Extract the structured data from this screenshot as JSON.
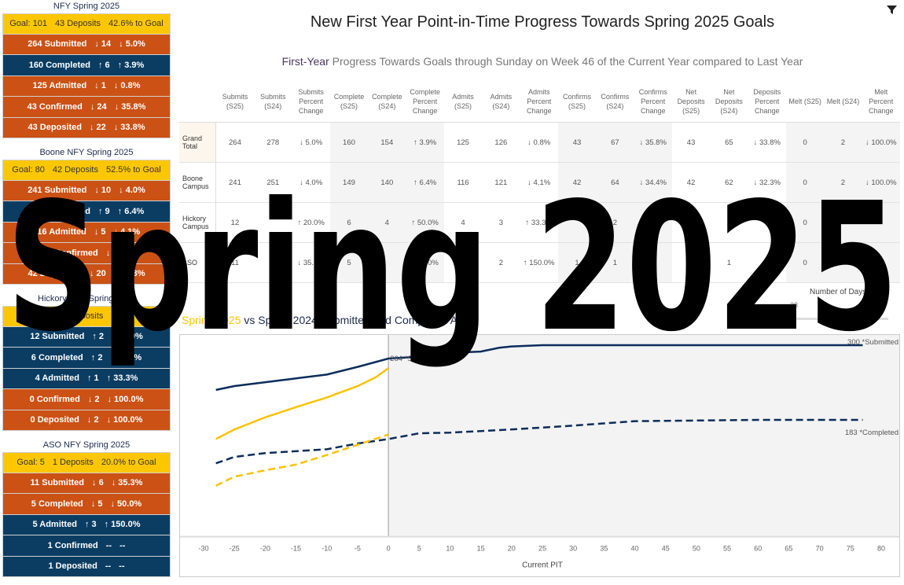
{
  "left_panel": [
    {
      "title": "NFY Spring 2025",
      "goal": [
        "Goal: 101",
        "43 Deposits",
        "42.6% to Goal"
      ],
      "rows": [
        {
          "parts": [
            "264 Submitted",
            "↓ 14",
            "↓ 5.0%"
          ],
          "color": "#cb5115"
        },
        {
          "parts": [
            "160 Completed",
            "↑ 6",
            "↑ 3.9%"
          ],
          "color": "#0b3d63"
        },
        {
          "parts": [
            "125 Admitted",
            "↓ 1",
            "↓ 0.8%"
          ],
          "color": "#cb5115"
        },
        {
          "parts": [
            "43 Confirmed",
            "↓ 24",
            "↓ 35.8%"
          ],
          "color": "#cb5115"
        },
        {
          "parts": [
            "43 Deposited",
            "↓ 22",
            "↓ 33.8%"
          ],
          "color": "#cb5115"
        }
      ]
    },
    {
      "title": "Boone NFY Spring 2025",
      "goal": [
        "Goal: 80",
        "42 Deposits",
        "52.5% to Goal"
      ],
      "rows": [
        {
          "parts": [
            "241 Submitted",
            "↓ 10",
            "↓ 4.0%"
          ],
          "color": "#cb5115"
        },
        {
          "parts": [
            "149 Completed",
            "↑ 9",
            "↑ 6.4%"
          ],
          "color": "#0b3d63"
        },
        {
          "parts": [
            "116 Admitted",
            "↓ 5",
            "↓ 4.1%"
          ],
          "color": "#cb5115"
        },
        {
          "parts": [
            "42 Confirmed",
            "↓ 22",
            ""
          ],
          "color": "#cb5115"
        },
        {
          "parts": [
            "42 Deposited",
            "↓ 20",
            "↓ 32.3%"
          ],
          "color": "#cb5115"
        }
      ]
    },
    {
      "title": "Hickory NFY Spring 2025",
      "goal": [
        "",
        "Deposits",
        ""
      ],
      "rows": [
        {
          "parts": [
            "12 Submitted",
            "↑ 2",
            "↑ 20.0%"
          ],
          "color": "#0b3d63"
        },
        {
          "parts": [
            "6 Completed",
            "↑ 2",
            "↑ 50.0%"
          ],
          "color": "#0b3d63"
        },
        {
          "parts": [
            "4 Admitted",
            "↑ 1",
            "↑ 33.3%"
          ],
          "color": "#0b3d63"
        },
        {
          "parts": [
            "0 Confirmed",
            "↓ 2",
            "↓ 100.0%"
          ],
          "color": "#cb5115"
        },
        {
          "parts": [
            "0 Deposited",
            "↓ 2",
            "↓ 100.0%"
          ],
          "color": "#cb5115"
        }
      ]
    },
    {
      "title": "ASO NFY Spring 2025",
      "goal": [
        "Goal: 5",
        "1 Deposits",
        "20.0% to Goal"
      ],
      "rows": [
        {
          "parts": [
            "11 Submitted",
            "↓ 6",
            "↓ 35.3%"
          ],
          "color": "#cb5115"
        },
        {
          "parts": [
            "5 Completed",
            "↓ 5",
            "↓ 50.0%"
          ],
          "color": "#cb5115"
        },
        {
          "parts": [
            "5 Admitted",
            "↑ 3",
            "↑ 150.0%"
          ],
          "color": "#0b3d63"
        },
        {
          "parts": [
            "1 Confirmed",
            "--",
            "--"
          ],
          "color": "#0b3d63"
        },
        {
          "parts": [
            "1 Deposited",
            "--",
            "--"
          ],
          "color": "#0b3d63"
        }
      ]
    }
  ],
  "goal_color": "#fdc700",
  "header": {
    "title": "New First Year Point-in-Time Progress Towards Spring 2025 Goals",
    "subtitle_highlight": "First-Year",
    "subtitle_rest": " Progress Towards Goals through Sunday on Week 46 of the Current Year compared to Last Year",
    "filter_icon": "funnel-icon"
  },
  "table": {
    "columns": [
      "Submits (S25)",
      "Submits (S24)",
      "Submits Percent Change",
      "Complete (S25)",
      "Complete (S24)",
      "Complete Percent Change",
      "Admits (S25)",
      "Admits (S24)",
      "Admits Percent Change",
      "Confirms (S25)",
      "Confirms (S24)",
      "Confirms Percent Change",
      "Net Deposits (S25)",
      "Net Deposits (S24)",
      "Deposits Percent Change",
      "Melt (S25)",
      "Melt (S24)",
      "Melt Percent Change"
    ],
    "rows": [
      {
        "label": "Grand Total",
        "values": [
          "264",
          "278",
          "↓ 5.0%",
          "160",
          "154",
          "↑ 3.9%",
          "125",
          "126",
          "↓ 0.8%",
          "43",
          "67",
          "↓ 35.8%",
          "43",
          "65",
          "↓ 33.8%",
          "0",
          "2",
          "↓ 100.0%"
        ]
      },
      {
        "label": "Boone Campus",
        "values": [
          "241",
          "251",
          "↓ 4.0%",
          "149",
          "140",
          "↑ 6.4%",
          "116",
          "121",
          "↓ 4.1%",
          "42",
          "64",
          "↓ 34.4%",
          "42",
          "62",
          "↓ 32.3%",
          "0",
          "2",
          "↓ 100.0%"
        ]
      },
      {
        "label": "Hickory Campus",
        "values": [
          "12",
          "",
          "↑ 20.0%",
          "6",
          "4",
          "↑ 50.0%",
          "4",
          "3",
          "↑ 33.3%",
          "",
          "2",
          "",
          "",
          "2",
          "",
          "0",
          "",
          ""
        ]
      },
      {
        "label": "ASO",
        "values": [
          "11",
          "",
          "↓ 35.3%",
          "5",
          "",
          "↓ 50.0%",
          "",
          "2",
          "↑ 150.0%",
          "1",
          "1",
          "",
          "",
          "1",
          "",
          "0",
          "",
          ""
        ]
      }
    ]
  },
  "slider": {
    "label": "Number of Days",
    "value": "-28"
  },
  "chart_title": {
    "highlight": "Spring 2025",
    "rest": " vs Spring 2024 Submitted and Completed Apps"
  },
  "watermark": "Spring 2025",
  "chart_data": {
    "type": "line",
    "xlabel": "Current PIT",
    "xlim": [
      -32,
      82
    ],
    "ylim": [
      0,
      300
    ],
    "x_ticks": [
      -30,
      -25,
      -20,
      -15,
      -10,
      -5,
      0,
      5,
      10,
      15,
      20,
      25,
      30,
      35,
      40,
      45,
      50,
      55,
      60,
      65,
      70,
      75,
      80
    ],
    "series": [
      {
        "id": "s24-submitted",
        "color": "#0b2d5c",
        "dash": false,
        "x": [
          -28,
          -25,
          -20,
          -15,
          -10,
          -5,
          0,
          5,
          10,
          15,
          18,
          20,
          25,
          40,
          60,
          77
        ],
        "y": [
          230,
          236,
          242,
          248,
          254,
          266,
          279,
          282,
          288,
          290,
          296,
          298,
          300,
          300,
          300,
          300
        ]
      },
      {
        "id": "s25-submitted",
        "color": "#fcc200",
        "dash": false,
        "x": [
          -28,
          -25,
          -20,
          -15,
          -10,
          -5,
          -2,
          0
        ],
        "y": [
          153,
          168,
          187,
          203,
          218,
          236,
          250,
          264
        ]
      },
      {
        "id": "s24-completed",
        "color": "#0b2d5c",
        "dash": true,
        "x": [
          -28,
          -25,
          -20,
          -10,
          -5,
          0,
          5,
          10,
          20,
          30,
          40,
          50,
          60,
          77
        ],
        "y": [
          115,
          125,
          131,
          137,
          146,
          153,
          162,
          163,
          168,
          174,
          181,
          182,
          183,
          183
        ]
      },
      {
        "id": "s25-completed",
        "color": "#fcc200",
        "dash": true,
        "x": [
          -28,
          -25,
          -20,
          -15,
          -10,
          -5,
          0
        ],
        "y": [
          80,
          94,
          104,
          113,
          128,
          144,
          160
        ]
      }
    ],
    "annotations": [
      {
        "text": "264 *Submitted",
        "x": 0,
        "y": 279
      },
      {
        "text": "300 *Submitted",
        "x": 82,
        "y": 300
      },
      {
        "text": "183 *Completed",
        "x": 82,
        "y": 168
      }
    ],
    "current_line_x": 0
  }
}
